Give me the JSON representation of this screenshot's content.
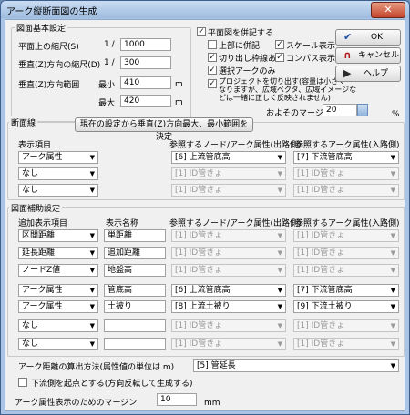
{
  "window": {
    "title": "アーク縦断面図の生成",
    "close": "✕"
  },
  "basic": {
    "group_title": "図面基本設定",
    "plan_scale_label": "平面上の縮尺(S)",
    "plan_scale_prefix": "1 /",
    "plan_scale_value": "1000",
    "vert_scale_label": "垂直(Z)方向の縮尺(D)",
    "vert_scale_prefix": "1 /",
    "vert_scale_value": "300",
    "vert_range_label": "垂直(Z)方向範囲",
    "min_label": "最小",
    "min_value": "410",
    "max_label": "最大",
    "max_value": "420",
    "unit": "m"
  },
  "plan": {
    "show_plan_label": "平面図を併記する",
    "top": "上部に併記",
    "scale": "スケール表示",
    "cutout": "切り出し枠線あり",
    "compass": "コンパス表示",
    "selected": "選択アークのみ",
    "project_text": [
      "プロジェクトを切り出す(容量は小さく",
      "なりますが、広域ベクタ、広域イメージな",
      "どは一緒に正しく反映されません)"
    ],
    "margin_label": "およそのマージン",
    "margin_value": "20",
    "margin_unit": "%"
  },
  "buttons": {
    "ok": "OK",
    "cancel": "キャンセル",
    "help": "ヘルプ",
    "ok_icon": "✔",
    "cancel_icon": "∩",
    "help_icon": "▶"
  },
  "section": {
    "group_title": "断面線",
    "set_button": "現在の設定から垂直(Z)方向最大、最小範囲を決定",
    "col_item": "表示項目",
    "col_node": "参照するノード/アーク属性(出路側)",
    "col_arc": "参照するアーク属性(入路側)",
    "rows": [
      {
        "item": "アーク属性",
        "node": "[6] 上流管底高",
        "arc": "[7] 下流管底高",
        "node_dis": false,
        "arc_dis": false
      },
      {
        "item": "なし",
        "node": "[1] ID管きょ",
        "arc": "[1] ID管きょ",
        "node_dis": true,
        "arc_dis": true
      },
      {
        "item": "なし",
        "node": "[1] ID管きょ",
        "arc": "[1] ID管きょ",
        "node_dis": true,
        "arc_dis": true
      }
    ]
  },
  "aux": {
    "group_title": "図面補助設定",
    "col_item": "追加表示項目",
    "col_name": "表示名称",
    "col_node": "参照するノード/アーク属性(出路側)",
    "col_arc": "参照するアーク属性(入路側)",
    "rows": [
      {
        "item": "区間距離",
        "name": "単距離",
        "node": "[1] ID管きょ",
        "arc": "[1] ID管きょ",
        "node_dis": true,
        "arc_dis": true
      },
      {
        "item": "延長距離",
        "name": "追加距離",
        "node": "[1] ID管きょ",
        "arc": "[1] ID管きょ",
        "node_dis": true,
        "arc_dis": true
      },
      {
        "item": "ノードZ値",
        "name": "地盤高",
        "node": "[1] ID管きょ",
        "arc": "[1] ID管きょ",
        "node_dis": true,
        "arc_dis": true
      },
      {
        "item": "アーク属性",
        "name": "管底高",
        "node": "[6] 上流管底高",
        "arc": "[7] 下流管底高",
        "node_dis": false,
        "arc_dis": false
      },
      {
        "item": "アーク属性",
        "name": "土被り",
        "node": "[8] 上流土被り",
        "arc": "[9] 下流土被り",
        "node_dis": false,
        "arc_dis": false
      },
      {
        "item": "なし",
        "name": "",
        "node": "[1] ID管きょ",
        "arc": "[1] ID管きょ",
        "node_dis": true,
        "arc_dis": true
      },
      {
        "item": "なし",
        "name": "",
        "node": "[1] ID管きょ",
        "arc": "[1] ID管きょ",
        "node_dis": true,
        "arc_dis": true
      }
    ]
  },
  "bottom": {
    "distance_label": "アーク距離の算出方法(属性値の単位は m)",
    "distance_value": "[5] 管延長",
    "reverse_label": "下流側を起点とする(方向反転して生成する)",
    "attr_margin_label": "アーク属性表示のためのマージン",
    "attr_margin_value": "10",
    "attr_margin_unit": "mm"
  }
}
